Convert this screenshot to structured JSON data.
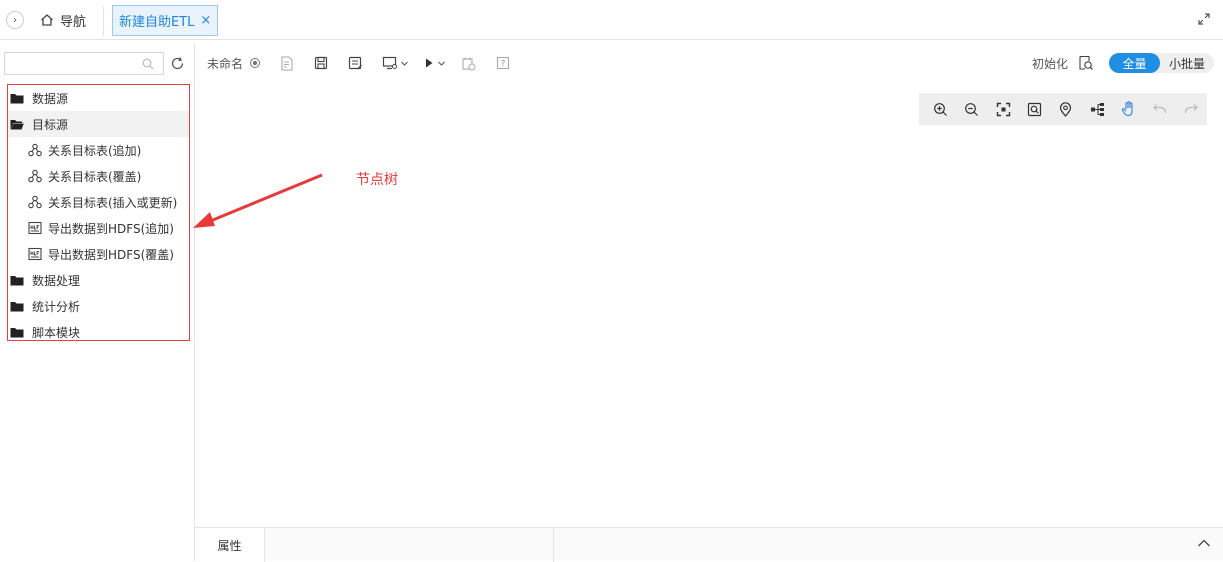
{
  "tabs": {
    "expand_icon": "chevron-right-icon",
    "nav_label": "导航",
    "active_label": "新建自助ETL",
    "close_symbol": "×"
  },
  "sidebar": {
    "search_placeholder": "",
    "tree": [
      {
        "type": "folder",
        "label": "数据源",
        "open": false
      },
      {
        "type": "folder",
        "label": "目标源",
        "open": true,
        "selected": true
      },
      {
        "type": "leaf",
        "label": "关系目标表(追加)",
        "icon": "relation-icon"
      },
      {
        "type": "leaf",
        "label": "关系目标表(覆盖)",
        "icon": "relation-icon"
      },
      {
        "type": "leaf",
        "label": "关系目标表(插入或更新)",
        "icon": "relation-icon"
      },
      {
        "type": "leaf",
        "label": "导出数据到HDFS(追加)",
        "icon": "hdfs-icon"
      },
      {
        "type": "leaf",
        "label": "导出数据到HDFS(覆盖)",
        "icon": "hdfs-icon"
      },
      {
        "type": "folder",
        "label": "数据处理",
        "open": false
      },
      {
        "type": "folder",
        "label": "统计分析",
        "open": false
      },
      {
        "type": "folder",
        "label": "脚本模块",
        "open": false
      }
    ]
  },
  "annotation": {
    "text": "节点树",
    "color": "#e83a3a"
  },
  "toolbar": {
    "name_label": "未命名",
    "init_label": "初始化",
    "mode_full": "全量",
    "mode_batch": "小批量",
    "accent": "#1f8ee3"
  },
  "bottom": {
    "properties_tab": "属性"
  }
}
